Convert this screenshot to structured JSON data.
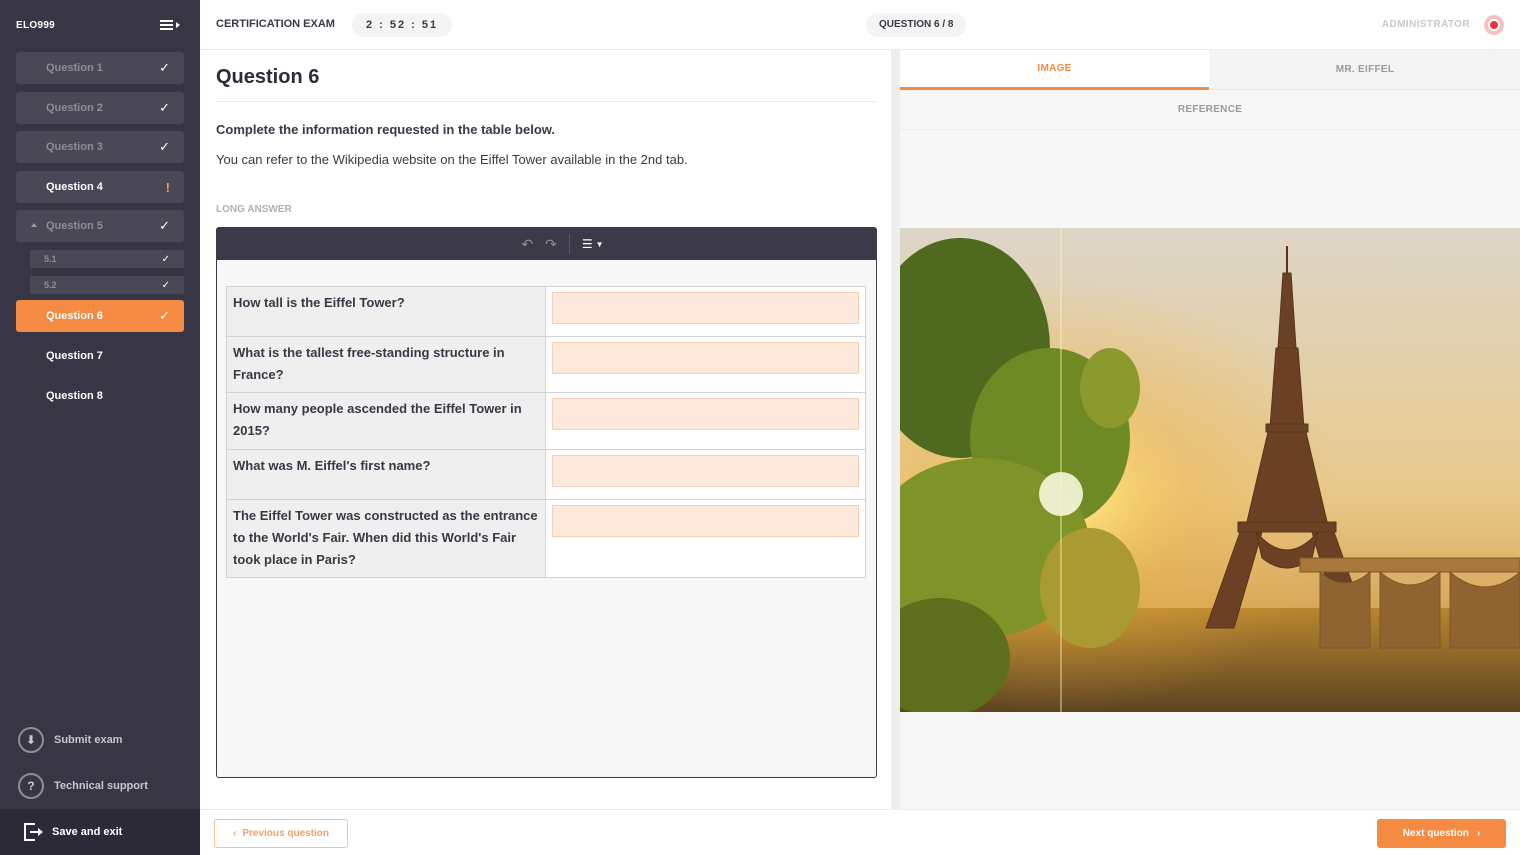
{
  "sidebar": {
    "exam_code": "ELO999",
    "questions": [
      {
        "label": "Question 1",
        "mark": "✓"
      },
      {
        "label": "Question 2",
        "mark": "✓"
      },
      {
        "label": "Question 3",
        "mark": "✓"
      },
      {
        "label": "Question 4",
        "mark": "!"
      },
      {
        "label": "Question 5",
        "mark": "✓"
      },
      {
        "label": "Question 6",
        "mark": "✓"
      },
      {
        "label": "Question 7",
        "mark": ""
      },
      {
        "label": "Question 8",
        "mark": ""
      }
    ],
    "subquestions": [
      {
        "label": "5.1",
        "mark": "✓"
      },
      {
        "label": "5.2",
        "mark": "✓"
      }
    ],
    "submit_label": "Submit exam",
    "support_label": "Technical support",
    "exit_label": "Save and exit"
  },
  "header": {
    "exam_title": "CERTIFICATION EXAM",
    "timer": "2 : 52 : 51",
    "question_counter": "QUESTION 6 / 8",
    "user": "ADMINISTRATOR"
  },
  "question": {
    "title": "Question 6",
    "instruction_1": "Complete the information requested in the table below.",
    "instruction_2": "You can refer to the Wikipedia website on the Eiffel Tower available in the 2nd tab.",
    "answer_type_label": "LONG ANSWER",
    "rows": [
      {
        "question": "How tall is the Eiffel Tower?",
        "answer": ""
      },
      {
        "question": "What is the tallest free-standing structure in France?",
        "answer": ""
      },
      {
        "question": "How many people ascended the Eiffel Tower in 2015?",
        "answer": ""
      },
      {
        "question": "What was M. Eiffel's first name?",
        "answer": ""
      },
      {
        "question": "The Eiffel Tower was constructed as the entrance to the World's Fair. When did this World's Fair took place in Paris?",
        "answer": ""
      }
    ]
  },
  "resources": {
    "tabs": [
      "IMAGE",
      "MR. EIFFEL",
      "REFERENCE"
    ],
    "active_tab": "IMAGE"
  },
  "footer": {
    "prev_label": "Previous question",
    "next_label": "Next question"
  },
  "colors": {
    "accent": "#f58a42",
    "sidebar_bg": "#383645",
    "answer_bg": "#fde9dc"
  }
}
